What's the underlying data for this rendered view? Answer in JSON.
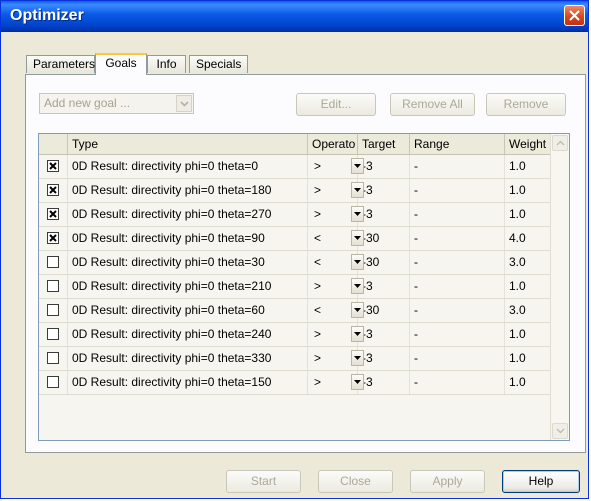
{
  "window": {
    "title": "Optimizer"
  },
  "tabs": [
    {
      "label": "Parameters"
    },
    {
      "label": "Goals"
    },
    {
      "label": "Info"
    },
    {
      "label": "Specials"
    }
  ],
  "toolbar": {
    "add_goal": "Add new goal ...",
    "edit": "Edit...",
    "remove_all": "Remove All",
    "remove": "Remove"
  },
  "table": {
    "columns": [
      "Type",
      "Operato",
      "Target",
      "Range",
      "Weight"
    ],
    "rows": [
      {
        "checked": true,
        "type": "0D Result: directivity phi=0 theta=0",
        "op": ">",
        "target": "-3",
        "range": "-",
        "weight": "1.0"
      },
      {
        "checked": true,
        "type": "0D Result: directivity phi=0 theta=180",
        "op": ">",
        "target": "-3",
        "range": "-",
        "weight": "1.0"
      },
      {
        "checked": true,
        "type": "0D Result: directivity phi=0 theta=270",
        "op": ">",
        "target": "-3",
        "range": "-",
        "weight": "1.0"
      },
      {
        "checked": true,
        "type": "0D Result: directivity phi=0 theta=90",
        "op": "<",
        "target": "-30",
        "range": "-",
        "weight": "4.0"
      },
      {
        "checked": false,
        "type": "0D Result: directivity phi=0 theta=30",
        "op": "<",
        "target": "-30",
        "range": "-",
        "weight": "3.0"
      },
      {
        "checked": false,
        "type": "0D Result: directivity phi=0 theta=210",
        "op": ">",
        "target": "-3",
        "range": "-",
        "weight": "1.0"
      },
      {
        "checked": false,
        "type": "0D Result: directivity phi=0 theta=60",
        "op": "<",
        "target": "-30",
        "range": "-",
        "weight": "3.0"
      },
      {
        "checked": false,
        "type": "0D Result: directivity phi=0 theta=240",
        "op": ">",
        "target": "-3",
        "range": "-",
        "weight": "1.0"
      },
      {
        "checked": false,
        "type": "0D Result: directivity phi=0 theta=330",
        "op": ">",
        "target": "-3",
        "range": "-",
        "weight": "1.0"
      },
      {
        "checked": false,
        "type": "0D Result: directivity phi=0 theta=150",
        "op": ">",
        "target": "-3",
        "range": "-",
        "weight": "1.0"
      }
    ]
  },
  "footer": {
    "start": "Start",
    "close": "Close",
    "apply": "Apply",
    "help": "Help"
  },
  "colors": {
    "titlebar": "#0a5ae6",
    "dialog_bg": "#ece9d8",
    "close_button": "#d9471f"
  }
}
